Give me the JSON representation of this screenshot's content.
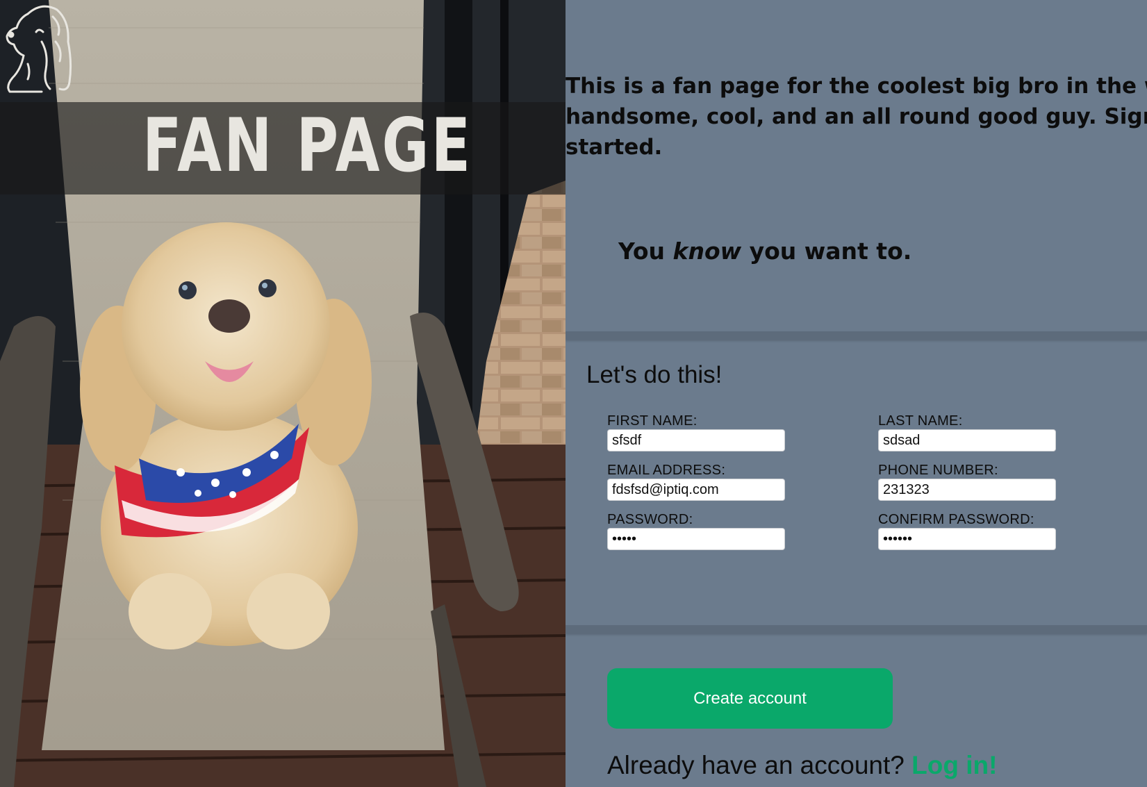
{
  "hero": {
    "logo_text": "FAN PAGE"
  },
  "intro": {
    "line1": "This is a fan page for the coolest big bro in the world. He is",
    "line2": "handsome, cool, and an all round good guy. Sign up to get",
    "line3": "started."
  },
  "tagline": {
    "before": "You ",
    "emphasis": "know",
    "after": " you want to."
  },
  "form": {
    "title": "Let's do this!",
    "fields": [
      {
        "label": "FIRST NAME:",
        "value": "sfsdf"
      },
      {
        "label": "LAST NAME:",
        "value": "sdsad"
      },
      {
        "label": "EMAIL ADDRESS:",
        "value": "fdsfsd@iptiq.com"
      },
      {
        "label": "PHONE NUMBER:",
        "value": "231323"
      },
      {
        "label": "PASSWORD:",
        "value": "•••••"
      },
      {
        "label": "CONFIRM PASSWORD:",
        "value": "••••••"
      }
    ],
    "submit_label": "Create account"
  },
  "login": {
    "prompt": "Already have an account? ",
    "link_label": "Log in!"
  },
  "colors": {
    "background": "#6b7b8d",
    "accent": "#0aa86a"
  }
}
